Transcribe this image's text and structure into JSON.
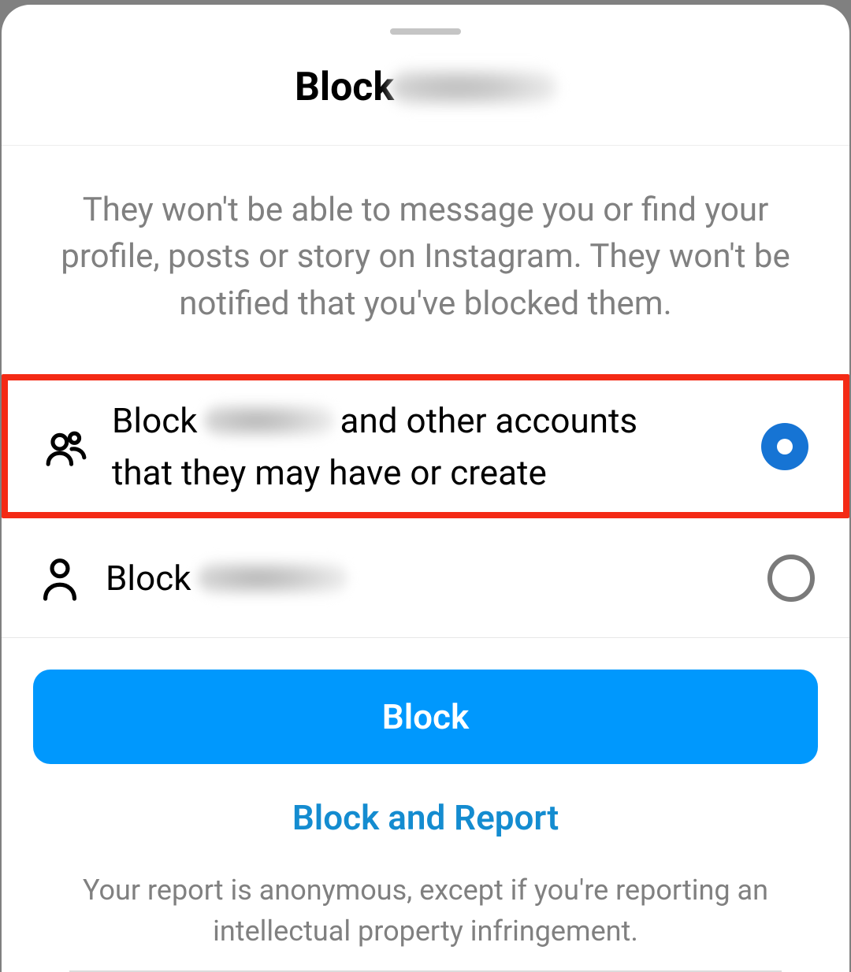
{
  "header": {
    "title": "Block"
  },
  "description": "They won't be able to message you or find your profile, posts or story on Instagram. They won't be notified that you've blocked them.",
  "options": {
    "block_all": {
      "prefix": "Block",
      "suffix": "and other accounts",
      "line2": "that they may have or create",
      "selected": true
    },
    "block_one": {
      "prefix": "Block",
      "selected": false
    }
  },
  "actions": {
    "block_label": "Block",
    "block_report_label": "Block and Report"
  },
  "footnote": "Your report is anonymous, except if you're reporting an intellectual property infringement."
}
